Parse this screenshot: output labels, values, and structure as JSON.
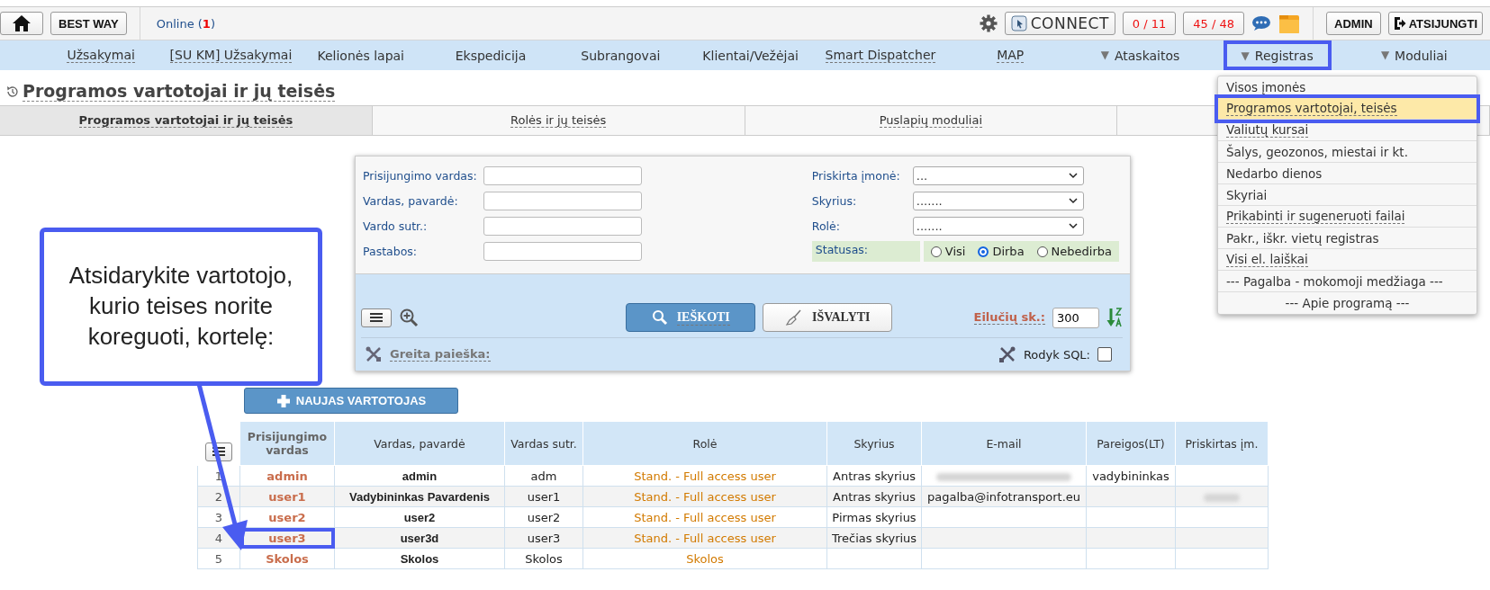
{
  "top_bar": {
    "brand": "BEST WAY",
    "online": "Online (**1**)",
    "connect": "CONNECT",
    "counters": [
      "0 / 11",
      "45 / 48"
    ],
    "admin": "ADMIN",
    "logout": "ATSIJUNGTI"
  },
  "menu": [
    {
      "label": "Užsakymai",
      "underlined": true,
      "highlighted": false
    },
    {
      "label": "[SU KM] Užsakymai",
      "underlined": true,
      "highlighted": false
    },
    {
      "label": "Kelionės lapai",
      "underlined": false,
      "highlighted": false
    },
    {
      "label": "Ekspedicija",
      "underlined": false,
      "highlighted": false
    },
    {
      "label": "Subrangovai",
      "underlined": false,
      "highlighted": false
    },
    {
      "label": "Klientai/Vežėjai",
      "underlined": false,
      "highlighted": false
    },
    {
      "label": "Smart Dispatcher",
      "underlined": true,
      "highlighted": false
    },
    {
      "label": "MAP",
      "underlined": true,
      "highlighted": false
    },
    {
      "label": "Ataskaitos",
      "caret": "▼",
      "underlined": false,
      "highlighted": false
    },
    {
      "label": "Registras",
      "caret": "▼",
      "underlined": false,
      "highlighted": true
    },
    {
      "label": "Moduliai",
      "caret": "▼",
      "underlined": false,
      "highlighted": false
    }
  ],
  "dropdown": [
    {
      "label": "Visos įmonės",
      "underlined": false,
      "selected": false
    },
    {
      "label": "Programos vartotojai, teisės",
      "underlined": true,
      "selected": true
    },
    {
      "label": "Valiutų kursai",
      "underlined": true,
      "selected": false
    },
    {
      "label": "Šalys, geozonos, miestai ir kt.",
      "underlined": false,
      "selected": false
    },
    {
      "label": "Nedarbo dienos",
      "underlined": false,
      "selected": false
    },
    {
      "label": "Skyriai",
      "underlined": false,
      "selected": false
    },
    {
      "label": "Prikabinti ir sugeneruoti failai",
      "underlined": true,
      "selected": false
    },
    {
      "label": "Pakr., iškr. vietų registras",
      "underlined": false,
      "selected": false
    },
    {
      "label": "Visi el. laiškai",
      "underlined": true,
      "selected": false
    },
    {
      "label": "--- Pagalba - mokomoji medžiaga ---",
      "underlined": false,
      "selected": false
    },
    {
      "label": "--- Apie programą ---",
      "underlined": false,
      "selected": false
    }
  ],
  "page_title": "Programos vartotojai ir jų teisės",
  "tabs": [
    {
      "label": "Programos vartotojai ir jų teisės",
      "selected": true
    },
    {
      "label": "Rolės ir jų teisės",
      "selected": false
    },
    {
      "label": "Puslapių moduliai",
      "selected": false
    }
  ],
  "search": {
    "fields": [
      {
        "label": "Prisijungimo vardas:"
      },
      {
        "label": "Vardas, pavardė:"
      },
      {
        "label": "Vardo sutr.:"
      },
      {
        "label": "Pastabos:"
      }
    ],
    "selects": [
      {
        "label": "Priskirta įmonė:",
        "value": "..."
      },
      {
        "label": "Skyrius:",
        "value": "......."
      },
      {
        "label": "Rolė:",
        "value": "......."
      }
    ],
    "status_label": "Statusas:",
    "status_options": [
      {
        "label": "Visi",
        "selected": false
      },
      {
        "label": "Dirba",
        "selected": true
      },
      {
        "label": "Nebedirba",
        "selected": false
      }
    ],
    "search_button": "IEŠKOTI",
    "clear_button": "IŠVALYTI",
    "rows_label": "Eilučių sk.:",
    "rows_value": "300",
    "quick_search": "Greita paieška:",
    "sql_label": "Rodyk SQL:",
    "sql_checked": false
  },
  "new_button": "NAUJAS VARTOTOJAS",
  "table": {
    "columns": [
      "Prisijungimo vardas",
      "Vardas, pavardė",
      "Vardas sutr.",
      "Rolė",
      "Skyrius",
      "E-mail",
      "Pareigos(LT)",
      "Priskirtas įm."
    ],
    "rows": [
      {
        "index": "1",
        "login": "admin",
        "name": "admin",
        "short": "adm",
        "role": "Stand. - Full access user",
        "department": "Antras skyrius",
        "email_blurred": true,
        "position": "vadybininkas",
        "company_blurred": false,
        "highlighted": false
      },
      {
        "index": "2",
        "login": "user1",
        "name": "Vadybininkas Pavardenis",
        "short": "user1",
        "role": "Stand. - Full access user",
        "department": "Antras skyrius",
        "email": "pagalba@infotransport.eu",
        "email_blurred": false,
        "company_blurred": true,
        "highlighted": false
      },
      {
        "index": "3",
        "login": "user2",
        "name": "user2",
        "short": "user2",
        "role": "Stand. - Full access user",
        "department": "Pirmas skyrius",
        "email_blurred": false,
        "company_blurred": false,
        "highlighted": false
      },
      {
        "index": "4",
        "login": "user3",
        "name": "user3d",
        "short": "user3",
        "role": "Stand. - Full access user",
        "department": "Trečias skyrius",
        "email_blurred": false,
        "company_blurred": false,
        "highlighted": true
      },
      {
        "index": "5",
        "login": "Skolos",
        "name": "Skolos",
        "short": "Skolos",
        "role": "Skolos",
        "email_blurred": false,
        "company_blurred": false,
        "highlighted": false
      }
    ]
  },
  "callout": "Atsidarykite vartotojo, kurio teises norite koreguoti, kortelę:"
}
